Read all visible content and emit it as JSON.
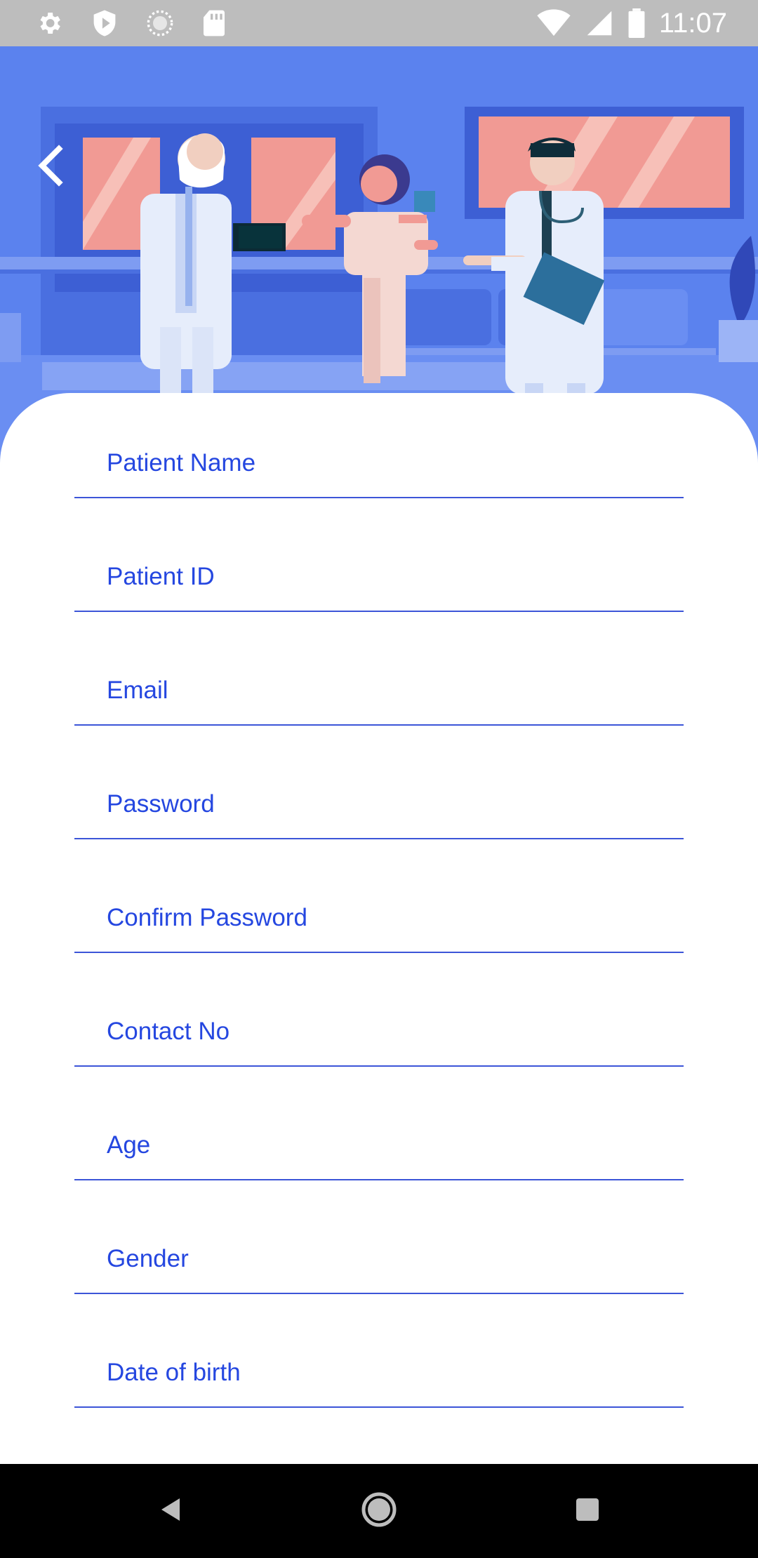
{
  "status_bar": {
    "time": "11:07",
    "left_icons": [
      "settings-icon",
      "play-protect-icon",
      "loading-icon",
      "sd-card-icon"
    ],
    "right_icons": [
      "wifi-icon",
      "signal-icon",
      "battery-icon"
    ]
  },
  "header": {
    "back_icon": "chevron-left-icon",
    "illustration": "hospital-staff-illustration"
  },
  "form": {
    "fields": [
      {
        "label": "Patient Name"
      },
      {
        "label": "Patient ID"
      },
      {
        "label": "Email"
      },
      {
        "label": "Password"
      },
      {
        "label": "Confirm Password"
      },
      {
        "label": "Contact No"
      },
      {
        "label": "Age"
      },
      {
        "label": "Gender"
      },
      {
        "label": "Date of birth"
      }
    ]
  },
  "nav_bar": {
    "buttons": [
      "back-nav-icon",
      "home-nav-icon",
      "recents-nav-icon"
    ]
  },
  "colors": {
    "accent": "#2547e0",
    "header_bg": "#5b82ee",
    "status_bar": "#bdbdbd",
    "nav_bar": "#000000"
  }
}
